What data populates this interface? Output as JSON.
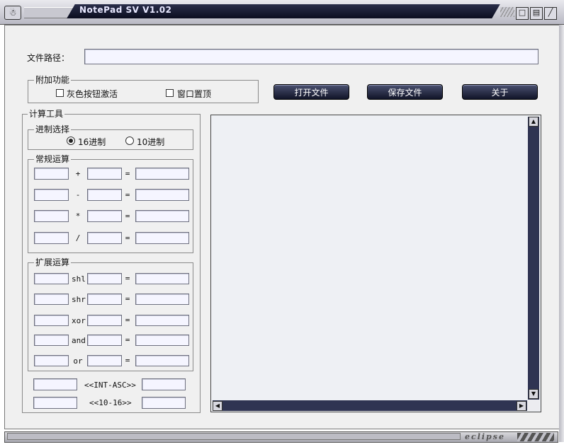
{
  "window": {
    "title": "NotePad SV V1.02",
    "icon": "app-icon",
    "brand": "eclipse"
  },
  "path": {
    "label": "文件路径：",
    "value": ""
  },
  "extra": {
    "legend": "附加功能",
    "gray_activate": {
      "label": "灰色按钮激活",
      "checked": false
    },
    "topmost": {
      "label": "窗口置顶",
      "checked": false
    }
  },
  "buttons": {
    "open": "打开文件",
    "save": "保存文件",
    "about": "关于"
  },
  "calc": {
    "legend": "计算工具",
    "radix": {
      "legend": "进制选择",
      "hex": "16进制",
      "dec": "10进制",
      "selected": "16进制"
    },
    "basic": {
      "legend": "常规运算",
      "ops": [
        "+",
        "-",
        "*",
        "/"
      ],
      "eq": "="
    },
    "ext": {
      "legend": "扩展运算",
      "ops": [
        "shl",
        "shr",
        "xor",
        "and",
        "or"
      ],
      "eq": "="
    },
    "convert": {
      "int_asc": "<<INT-ASC>>",
      "hex_dec": "<<10-16>>"
    }
  },
  "editor": {
    "content": ""
  }
}
